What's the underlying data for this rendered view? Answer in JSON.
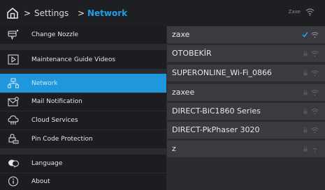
{
  "breadcrumb": {
    "separator": ">",
    "settings": "Settings",
    "network": "Network"
  },
  "status": {
    "connected_ssid": "Zaxe",
    "wifi_icon": "wifi-icon"
  },
  "colors": {
    "accent": "#1f97dc",
    "check": "#1ea0e8"
  },
  "sidebar": {
    "items": [
      {
        "label": "Change Nozzle",
        "icon": "nozzle-icon",
        "active": false
      },
      {
        "label": "Maintenance Guide Videos",
        "icon": "play-icon",
        "active": false
      },
      {
        "label": "Network",
        "icon": "network-icon",
        "active": true
      },
      {
        "label": "Mail Notification",
        "icon": "mail-icon",
        "active": false
      },
      {
        "label": "Cloud Services",
        "icon": "cloud-icon",
        "active": false
      },
      {
        "label": "Pin Code Protection",
        "icon": "pin-lock-icon",
        "active": false
      },
      {
        "label": "Language",
        "icon": "language-icon",
        "active": false
      },
      {
        "label": "About",
        "icon": "info-icon",
        "active": false
      }
    ]
  },
  "networks": [
    {
      "ssid": "zaxe",
      "connected": true,
      "locked": false
    },
    {
      "ssid": "OTOBEKİR",
      "connected": false,
      "locked": true
    },
    {
      "ssid": "SUPERONLINE_Wi-Fi_0866",
      "connected": false,
      "locked": true
    },
    {
      "ssid": "zaxee",
      "connected": false,
      "locked": true
    },
    {
      "ssid": "DIRECT-BiC1860 Series",
      "connected": false,
      "locked": true
    },
    {
      "ssid": "DIRECT-PkPhaser 3020",
      "connected": false,
      "locked": true
    },
    {
      "ssid": "z",
      "connected": false,
      "locked": true
    }
  ]
}
